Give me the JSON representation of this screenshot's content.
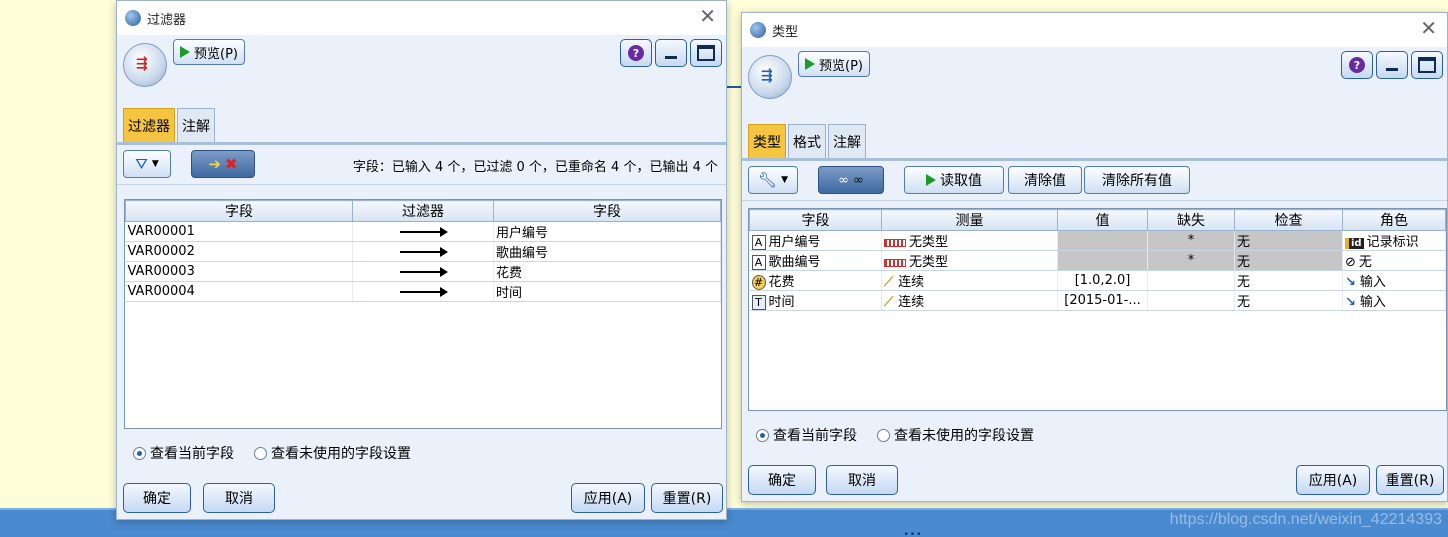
{
  "filter_window": {
    "title": "过滤器",
    "preview_label": "预览(P)",
    "help_glyph": "?",
    "tabs": [
      "过滤器",
      "注解"
    ],
    "field_info": "字段：已输入 4 个，已过滤 0 个，已重命名 4 个，已输出 4 个",
    "columns": [
      "字段",
      "过滤器",
      "字段"
    ],
    "rows": [
      {
        "in": "VAR00001",
        "out": "用户编号"
      },
      {
        "in": "VAR00002",
        "out": "歌曲编号"
      },
      {
        "in": "VAR00003",
        "out": "花费"
      },
      {
        "in": "VAR00004",
        "out": "时间"
      }
    ],
    "radio_current": "查看当前字段",
    "radio_unused": "查看未使用的字段设置",
    "ok": "确定",
    "cancel": "取消",
    "apply": "应用(A)",
    "reset": "重置(R)"
  },
  "type_window": {
    "title": "类型",
    "preview_label": "预览(P)",
    "help_glyph": "?",
    "tabs": [
      "类型",
      "格式",
      "注解"
    ],
    "read_values": "读取值",
    "clear_values": "清除值",
    "clear_all_values": "清除所有值",
    "columns": [
      "字段",
      "测量",
      "值",
      "缺失",
      "检查",
      "角色"
    ],
    "rows": [
      {
        "type_icon": "A",
        "field": "用户编号",
        "measure": "无类型",
        "value": "",
        "missing": "*",
        "check": "无",
        "role": "记录标识",
        "role_icon": "id"
      },
      {
        "type_icon": "A",
        "field": "歌曲编号",
        "measure": "无类型",
        "value": "",
        "missing": "*",
        "check": "无",
        "role": "无",
        "role_icon": "⊘"
      },
      {
        "type_icon": "#",
        "field": "花费",
        "measure": "连续",
        "value": "[1.0,2.0]",
        "missing": "",
        "check": "无",
        "role": "输入",
        "role_icon": "↘"
      },
      {
        "type_icon": "T",
        "field": "时间",
        "measure": "连续",
        "value": "[2015-01-...",
        "missing": "",
        "check": "无",
        "role": "输入",
        "role_icon": "↘"
      }
    ],
    "radio_current": "查看当前字段",
    "radio_unused": "查看未使用的字段设置",
    "ok": "确定",
    "cancel": "取消",
    "apply": "应用(A)",
    "reset": "重置(R)"
  },
  "watermark": "https://blog.csdn.net/weixin_42214393"
}
